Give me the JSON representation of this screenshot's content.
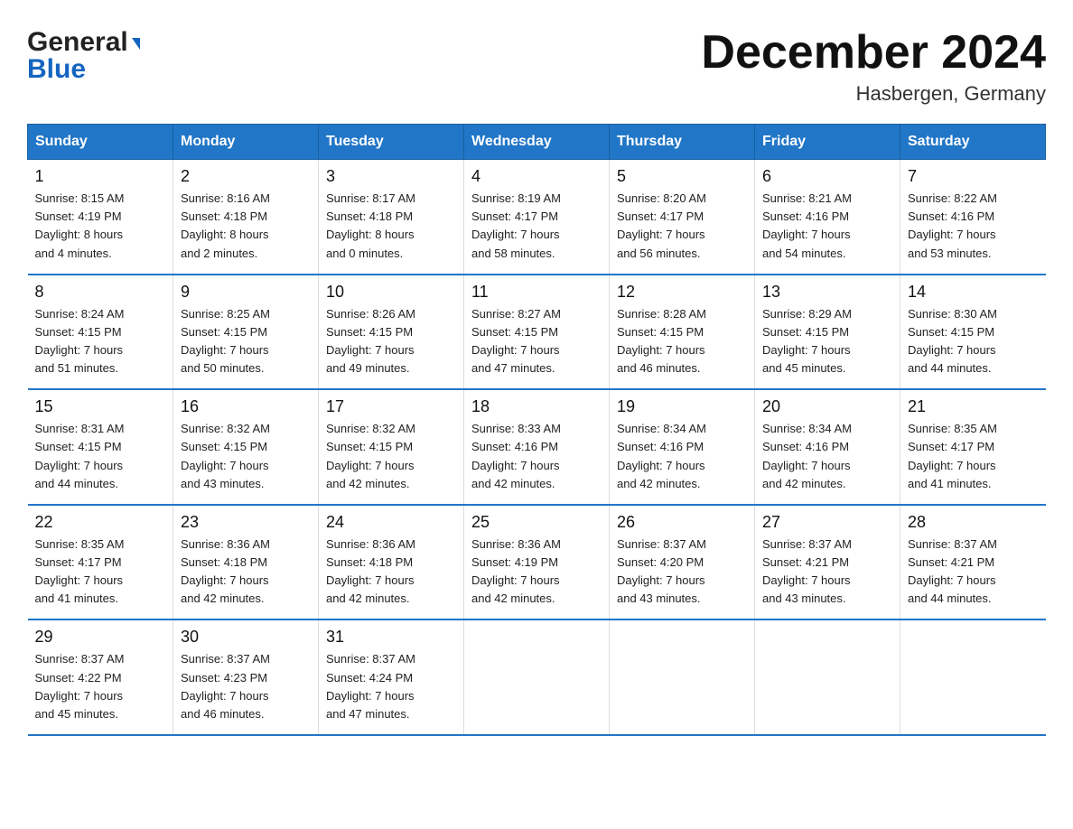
{
  "logo": {
    "line1": "General",
    "arrow": true,
    "line2": "Blue"
  },
  "title": "December 2024",
  "location": "Hasbergen, Germany",
  "days_of_week": [
    "Sunday",
    "Monday",
    "Tuesday",
    "Wednesday",
    "Thursday",
    "Friday",
    "Saturday"
  ],
  "weeks": [
    [
      {
        "day": "1",
        "sunrise": "8:15 AM",
        "sunset": "4:19 PM",
        "daylight": "8 hours and 4 minutes."
      },
      {
        "day": "2",
        "sunrise": "8:16 AM",
        "sunset": "4:18 PM",
        "daylight": "8 hours and 2 minutes."
      },
      {
        "day": "3",
        "sunrise": "8:17 AM",
        "sunset": "4:18 PM",
        "daylight": "8 hours and 0 minutes."
      },
      {
        "day": "4",
        "sunrise": "8:19 AM",
        "sunset": "4:17 PM",
        "daylight": "7 hours and 58 minutes."
      },
      {
        "day": "5",
        "sunrise": "8:20 AM",
        "sunset": "4:17 PM",
        "daylight": "7 hours and 56 minutes."
      },
      {
        "day": "6",
        "sunrise": "8:21 AM",
        "sunset": "4:16 PM",
        "daylight": "7 hours and 54 minutes."
      },
      {
        "day": "7",
        "sunrise": "8:22 AM",
        "sunset": "4:16 PM",
        "daylight": "7 hours and 53 minutes."
      }
    ],
    [
      {
        "day": "8",
        "sunrise": "8:24 AM",
        "sunset": "4:15 PM",
        "daylight": "7 hours and 51 minutes."
      },
      {
        "day": "9",
        "sunrise": "8:25 AM",
        "sunset": "4:15 PM",
        "daylight": "7 hours and 50 minutes."
      },
      {
        "day": "10",
        "sunrise": "8:26 AM",
        "sunset": "4:15 PM",
        "daylight": "7 hours and 49 minutes."
      },
      {
        "day": "11",
        "sunrise": "8:27 AM",
        "sunset": "4:15 PM",
        "daylight": "7 hours and 47 minutes."
      },
      {
        "day": "12",
        "sunrise": "8:28 AM",
        "sunset": "4:15 PM",
        "daylight": "7 hours and 46 minutes."
      },
      {
        "day": "13",
        "sunrise": "8:29 AM",
        "sunset": "4:15 PM",
        "daylight": "7 hours and 45 minutes."
      },
      {
        "day": "14",
        "sunrise": "8:30 AM",
        "sunset": "4:15 PM",
        "daylight": "7 hours and 44 minutes."
      }
    ],
    [
      {
        "day": "15",
        "sunrise": "8:31 AM",
        "sunset": "4:15 PM",
        "daylight": "7 hours and 44 minutes."
      },
      {
        "day": "16",
        "sunrise": "8:32 AM",
        "sunset": "4:15 PM",
        "daylight": "7 hours and 43 minutes."
      },
      {
        "day": "17",
        "sunrise": "8:32 AM",
        "sunset": "4:15 PM",
        "daylight": "7 hours and 42 minutes."
      },
      {
        "day": "18",
        "sunrise": "8:33 AM",
        "sunset": "4:16 PM",
        "daylight": "7 hours and 42 minutes."
      },
      {
        "day": "19",
        "sunrise": "8:34 AM",
        "sunset": "4:16 PM",
        "daylight": "7 hours and 42 minutes."
      },
      {
        "day": "20",
        "sunrise": "8:34 AM",
        "sunset": "4:16 PM",
        "daylight": "7 hours and 42 minutes."
      },
      {
        "day": "21",
        "sunrise": "8:35 AM",
        "sunset": "4:17 PM",
        "daylight": "7 hours and 41 minutes."
      }
    ],
    [
      {
        "day": "22",
        "sunrise": "8:35 AM",
        "sunset": "4:17 PM",
        "daylight": "7 hours and 41 minutes."
      },
      {
        "day": "23",
        "sunrise": "8:36 AM",
        "sunset": "4:18 PM",
        "daylight": "7 hours and 42 minutes."
      },
      {
        "day": "24",
        "sunrise": "8:36 AM",
        "sunset": "4:18 PM",
        "daylight": "7 hours and 42 minutes."
      },
      {
        "day": "25",
        "sunrise": "8:36 AM",
        "sunset": "4:19 PM",
        "daylight": "7 hours and 42 minutes."
      },
      {
        "day": "26",
        "sunrise": "8:37 AM",
        "sunset": "4:20 PM",
        "daylight": "7 hours and 43 minutes."
      },
      {
        "day": "27",
        "sunrise": "8:37 AM",
        "sunset": "4:21 PM",
        "daylight": "7 hours and 43 minutes."
      },
      {
        "day": "28",
        "sunrise": "8:37 AM",
        "sunset": "4:21 PM",
        "daylight": "7 hours and 44 minutes."
      }
    ],
    [
      {
        "day": "29",
        "sunrise": "8:37 AM",
        "sunset": "4:22 PM",
        "daylight": "7 hours and 45 minutes."
      },
      {
        "day": "30",
        "sunrise": "8:37 AM",
        "sunset": "4:23 PM",
        "daylight": "7 hours and 46 minutes."
      },
      {
        "day": "31",
        "sunrise": "8:37 AM",
        "sunset": "4:24 PM",
        "daylight": "7 hours and 47 minutes."
      },
      null,
      null,
      null,
      null
    ]
  ],
  "labels": {
    "sunrise": "Sunrise:",
    "sunset": "Sunset:",
    "daylight": "Daylight:"
  }
}
